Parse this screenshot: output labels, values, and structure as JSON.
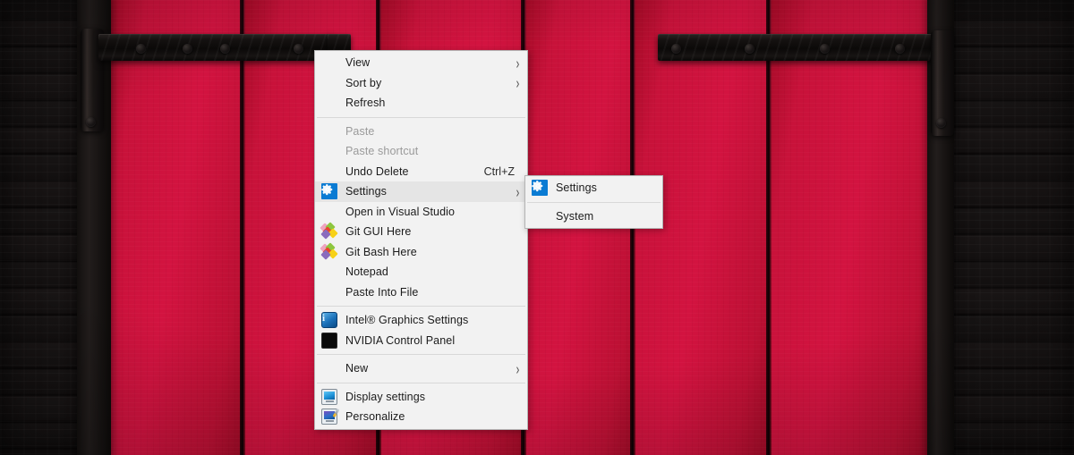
{
  "desktop": {
    "wallpaper_description": "red-barn-door-with-black-iron-hinges",
    "colors": {
      "panel_red": "#d31340",
      "panel_red_dark": "#9c0a25",
      "wood_black": "#131010",
      "iron_black": "#0b0908"
    }
  },
  "context_menu": {
    "name": "desktop-context-menu",
    "items": [
      {
        "id": "view",
        "label": "View",
        "icon": "",
        "accel": "",
        "submenu": true,
        "disabled": false,
        "selected": false
      },
      {
        "id": "sort-by",
        "label": "Sort by",
        "icon": "",
        "accel": "",
        "submenu": true,
        "disabled": false,
        "selected": false
      },
      {
        "id": "refresh",
        "label": "Refresh",
        "icon": "",
        "accel": "",
        "submenu": false,
        "disabled": false,
        "selected": false
      },
      {
        "id": "separator-1",
        "type": "separator"
      },
      {
        "id": "paste",
        "label": "Paste",
        "icon": "",
        "accel": "",
        "submenu": false,
        "disabled": true,
        "selected": false
      },
      {
        "id": "paste-shortcut",
        "label": "Paste shortcut",
        "icon": "",
        "accel": "",
        "submenu": false,
        "disabled": true,
        "selected": false
      },
      {
        "id": "undo-delete",
        "label": "Undo Delete",
        "icon": "",
        "accel": "Ctrl+Z",
        "submenu": false,
        "disabled": false,
        "selected": false
      },
      {
        "id": "settings",
        "label": "Settings",
        "icon": "gear-icon",
        "accel": "",
        "submenu": true,
        "disabled": false,
        "selected": true
      },
      {
        "id": "open-in-vs",
        "label": "Open in Visual Studio",
        "icon": "",
        "accel": "",
        "submenu": false,
        "disabled": false,
        "selected": false
      },
      {
        "id": "git-gui-here",
        "label": "Git GUI Here",
        "icon": "git-icon",
        "accel": "",
        "submenu": false,
        "disabled": false,
        "selected": false
      },
      {
        "id": "git-bash-here",
        "label": "Git Bash Here",
        "icon": "git-icon",
        "accel": "",
        "submenu": false,
        "disabled": false,
        "selected": false
      },
      {
        "id": "notepad",
        "label": "Notepad",
        "icon": "",
        "accel": "",
        "submenu": false,
        "disabled": false,
        "selected": false
      },
      {
        "id": "paste-into-file",
        "label": "Paste Into File",
        "icon": "",
        "accel": "",
        "submenu": false,
        "disabled": false,
        "selected": false
      },
      {
        "id": "separator-2",
        "type": "separator"
      },
      {
        "id": "intel-graphics",
        "label": "Intel® Graphics Settings",
        "icon": "intel-icon",
        "accel": "",
        "submenu": false,
        "disabled": false,
        "selected": false
      },
      {
        "id": "nvidia-panel",
        "label": "NVIDIA Control Panel",
        "icon": "nvidia-icon",
        "accel": "",
        "submenu": false,
        "disabled": false,
        "selected": false
      },
      {
        "id": "separator-3",
        "type": "separator"
      },
      {
        "id": "new",
        "label": "New",
        "icon": "",
        "accel": "",
        "submenu": true,
        "disabled": false,
        "selected": false
      },
      {
        "id": "separator-4",
        "type": "separator"
      },
      {
        "id": "display-settings",
        "label": "Display settings",
        "icon": "monitor-icon",
        "accel": "",
        "submenu": false,
        "disabled": false,
        "selected": false
      },
      {
        "id": "personalize",
        "label": "Personalize",
        "icon": "personalize-icon",
        "accel": "",
        "submenu": false,
        "disabled": false,
        "selected": false
      }
    ],
    "submenu_arrow_glyph": "›"
  },
  "settings_submenu": {
    "name": "settings-submenu",
    "items": [
      {
        "id": "sub-settings",
        "label": "Settings",
        "icon": "gear-icon",
        "submenu": false,
        "disabled": false,
        "selected": false
      },
      {
        "id": "separator-s1",
        "type": "separator"
      },
      {
        "id": "sub-system",
        "label": "System",
        "icon": "",
        "submenu": false,
        "disabled": false,
        "selected": false
      }
    ]
  },
  "icon_labels": {
    "intel_text": "i"
  }
}
